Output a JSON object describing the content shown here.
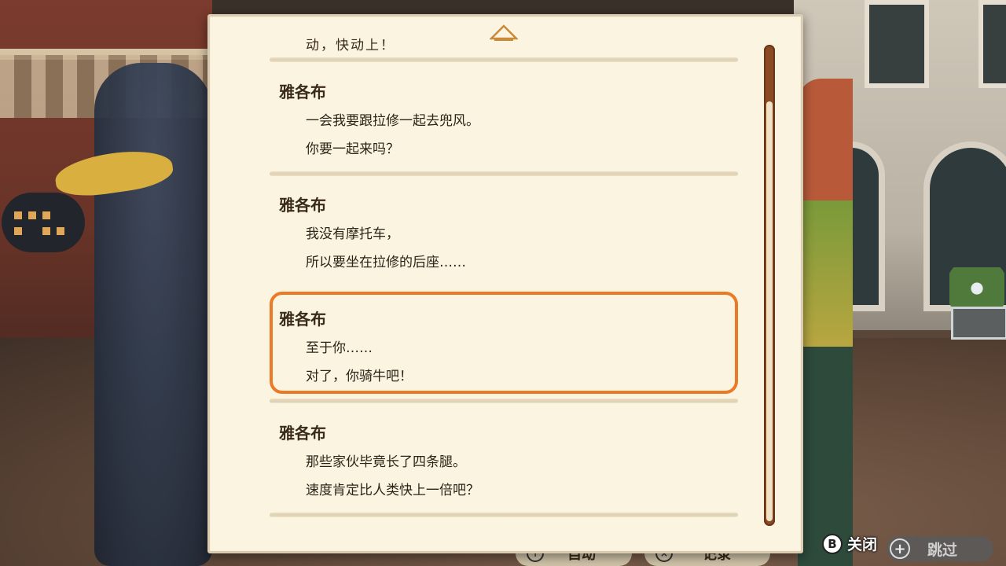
{
  "log": {
    "partial_top_line": "动，快动上！",
    "entries": [
      {
        "speaker": "雅各布",
        "lines": [
          "一会我要跟拉修一起去兜风。",
          "你要一起来吗？"
        ]
      },
      {
        "speaker": "雅各布",
        "lines": [
          "我没有摩托车，",
          "所以要坐在拉修的后座……"
        ]
      },
      {
        "speaker": "雅各布",
        "lines": [
          "至于你……",
          "对了，你骑牛吧！"
        ],
        "selected": true
      },
      {
        "speaker": "雅各布",
        "lines": [
          "那些家伙毕竟长了四条腿。",
          "速度肯定比人类快上一倍吧？"
        ]
      }
    ]
  },
  "controls": {
    "auto_label": "自动",
    "record_label": "记录",
    "close_button_glyph": "B",
    "close_label": "关闭",
    "skip_button_glyph": "+",
    "skip_label": "跳过"
  },
  "colors": {
    "panel_bg": "#fbf4e1",
    "highlight": "#ea7a25",
    "scrollbar": "#8a4a24"
  }
}
